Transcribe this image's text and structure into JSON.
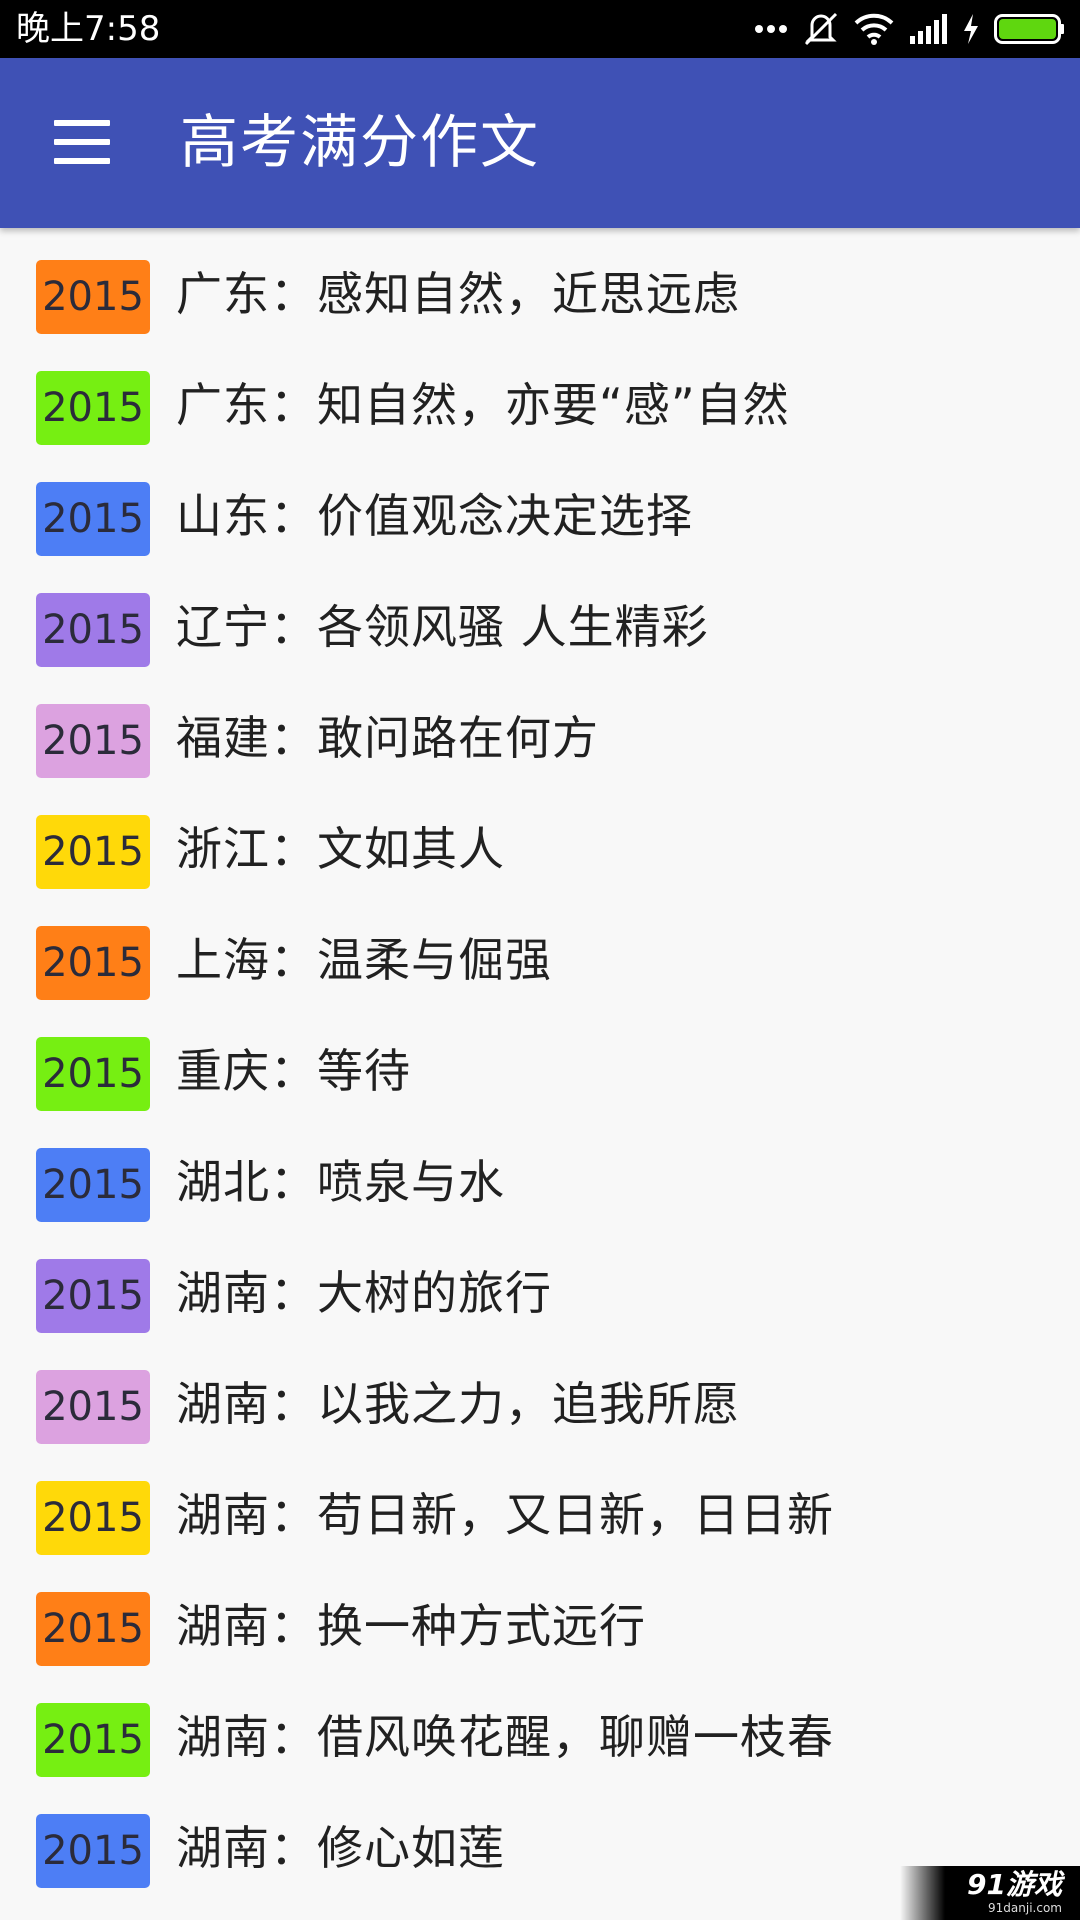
{
  "status_bar": {
    "time": "晚上7:58",
    "icons": [
      "more-icon",
      "mute-vibrate-icon",
      "wifi-icon",
      "signal-icon",
      "charging-icon",
      "battery-icon"
    ],
    "battery_color": "#5fd70f"
  },
  "app_bar": {
    "title": "高考满分作文",
    "color": "#3f51b5",
    "menu_icon": "hamburger-menu-icon"
  },
  "essays": [
    {
      "year": "2015",
      "title": "广东：感知自然，近思远虑",
      "color": "#ff7f17"
    },
    {
      "year": "2015",
      "title": "广东：知自然，亦要“感”自然",
      "color": "#76ef12"
    },
    {
      "year": "2015",
      "title": "山东：价值观念决定选择",
      "color": "#4d7ef5"
    },
    {
      "year": "2015",
      "title": "辽宁：各领风骚 人生精彩",
      "color": "#9f7ae8"
    },
    {
      "year": "2015",
      "title": "福建：敢问路在何方",
      "color": "#dca2e0"
    },
    {
      "year": "2015",
      "title": "浙江：文如其人",
      "color": "#ffd909"
    },
    {
      "year": "2015",
      "title": "上海：温柔与倔强",
      "color": "#ff7f17"
    },
    {
      "year": "2015",
      "title": "重庆：等待",
      "color": "#76ef12"
    },
    {
      "year": "2015",
      "title": "湖北：喷泉与水",
      "color": "#4d7ef5"
    },
    {
      "year": "2015",
      "title": "湖南：大树的旅行",
      "color": "#9f7ae8"
    },
    {
      "year": "2015",
      "title": "湖南：以我之力，追我所愿",
      "color": "#dca2e0"
    },
    {
      "year": "2015",
      "title": "湖南：苟日新，又日新，日日新",
      "color": "#ffd909"
    },
    {
      "year": "2015",
      "title": "湖南：换一种方式远行",
      "color": "#ff7f17"
    },
    {
      "year": "2015",
      "title": "湖南：借风唤花醒，聊赠一枝春",
      "color": "#76ef12"
    },
    {
      "year": "2015",
      "title": "湖南：修心如莲",
      "color": "#4d7ef5"
    }
  ],
  "watermark": {
    "logo_text": "91游戏",
    "url_text": "91danji.com"
  }
}
